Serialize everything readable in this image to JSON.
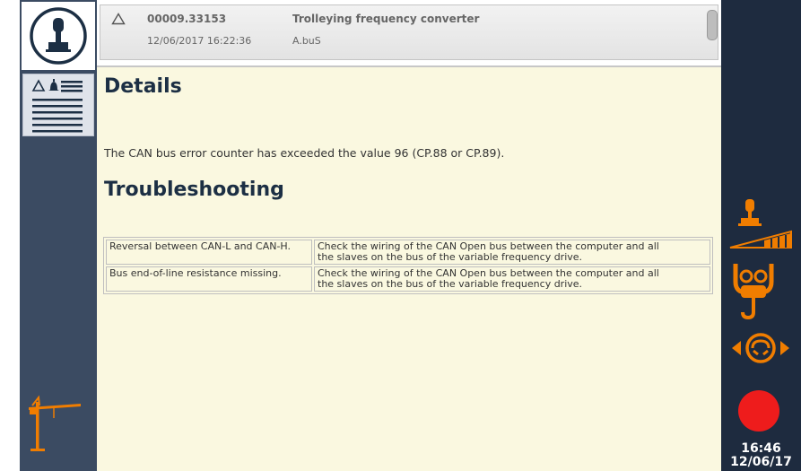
{
  "alarm": {
    "code": "00009.33153",
    "title": "Trolleying frequency converter",
    "timestamp": "12/06/2017 16:22:36",
    "source": "A.buS"
  },
  "details": {
    "heading": "Details",
    "description": "The CAN bus error counter has exceeded the value 96 (CP.88 or CP.89)."
  },
  "troubleshooting": {
    "heading": "Troubleshooting",
    "rows": [
      {
        "cause": "Reversal between CAN-L and CAN-H.",
        "remedy_line1": "Check the wiring of the CAN Open bus between the computer and all",
        "remedy_line2": "the slaves on the bus of the variable frequency drive."
      },
      {
        "cause": "Bus end-of-line resistance missing.",
        "remedy_line1": "Check the wiring of the CAN Open bus between the computer and all",
        "remedy_line2": "the slaves on the bus of the variable frequency drive."
      }
    ]
  },
  "clock": {
    "time": "16:46",
    "date": "12/06/17"
  },
  "colors": {
    "accent_orange": "#f07d00",
    "record_red": "#ee1c1c",
    "sidebar": "#3b4b62",
    "content_bg": "#faf8e0"
  },
  "icons": {
    "home": "joystick-icon",
    "alarm_list": "alarm-list-icon",
    "crane": "tower-crane-icon",
    "speed": "speed-joystick-icon",
    "hoist": "hoist-hook-icon",
    "slew": "slewing-icon",
    "record": "record-icon"
  }
}
